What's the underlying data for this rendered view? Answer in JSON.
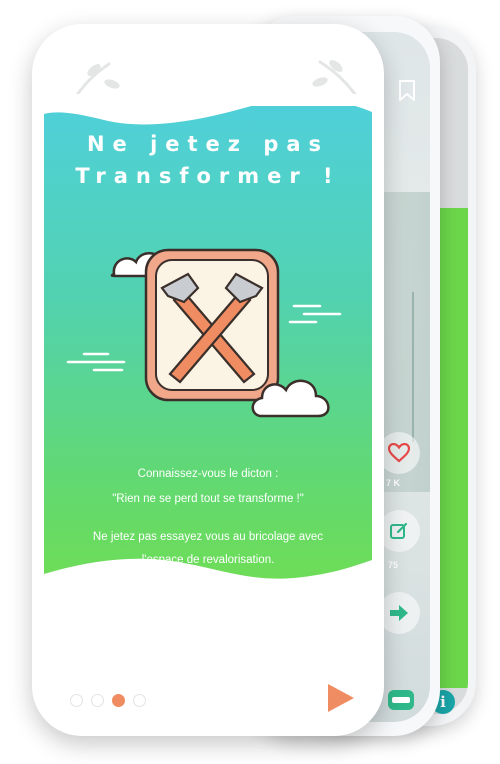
{
  "screen": {
    "heading_line1": "Ne jetez pas",
    "heading_line2": "Transformer !",
    "paragraph1_line1": "Connaissez-vous le dicton :",
    "paragraph1_line2": "\"Rien ne se perd tout se transforme !\"",
    "paragraph2_line1": "Ne jetez pas essayez vous au bricolage avec",
    "paragraph2_line2": "l'espace de revalorisation.",
    "illustration_icon": "crossed-hammers-icon"
  },
  "pager": {
    "total": 4,
    "active_index": 2
  },
  "background_cards": {
    "likes_count": "7 K",
    "edit_count": "75"
  },
  "colors": {
    "gradient_top": "#4fd0d9",
    "gradient_bottom": "#6edd55",
    "accent_orange": "#f08c61",
    "info_teal": "#1aa5a8",
    "heart_red": "#e84a4a"
  }
}
